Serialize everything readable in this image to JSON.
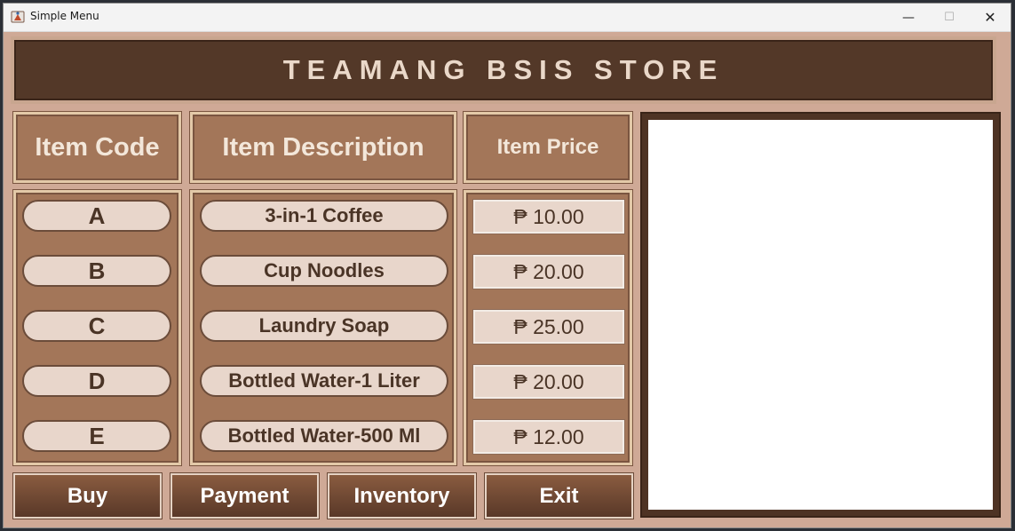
{
  "window": {
    "title": "Simple Menu"
  },
  "header": {
    "title": "TEAMANG BSIS STORE"
  },
  "columns": {
    "code": "Item Code",
    "description": "Item Description",
    "price": "Item Price"
  },
  "items": [
    {
      "code": "A",
      "description": "3-in-1 Coffee",
      "price": "₱ 10.00"
    },
    {
      "code": "B",
      "description": "Cup Noodles",
      "price": "₱ 20.00"
    },
    {
      "code": "C",
      "description": "Laundry Soap",
      "price": "₱ 25.00"
    },
    {
      "code": "D",
      "description": "Bottled Water-1 Liter",
      "price": "₱ 20.00"
    },
    {
      "code": "E",
      "description": "Bottled Water-500 Ml",
      "price": "₱ 12.00"
    }
  ],
  "buttons": {
    "buy": "Buy",
    "payment": "Payment",
    "inventory": "Inventory",
    "exit": "Exit"
  },
  "icons": {
    "minimize": "minimize-icon",
    "maximize": "maximize-icon",
    "close": "close-icon",
    "app": "java-icon"
  }
}
